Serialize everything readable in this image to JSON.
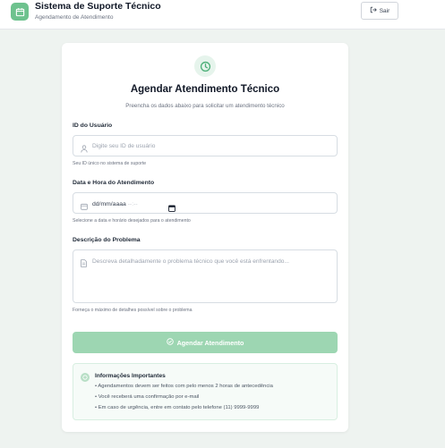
{
  "header": {
    "title": "Sistema de Suporte Técnico",
    "subtitle": "Agendamento de Atendimento",
    "logout_icon": "logout-icon",
    "logout_label": "Sair"
  },
  "form": {
    "title": "Agendar Atendimento Técnico",
    "subtitle": "Preencha os dados abaixo para solicitar um atendimento técnico",
    "user_id": {
      "label": "ID do Usuário",
      "placeholder": "Digite seu ID de usuário",
      "help": "Seu ID único no sistema de suporte",
      "icon": "user-icon"
    },
    "datetime": {
      "label": "Data e Hora do Atendimento",
      "date_placeholder": "dd/mm/aaaa",
      "time_placeholder": "--:--",
      "help": "Selecione a data e horário desejados para o atendimento",
      "icon": "calendar-icon"
    },
    "description": {
      "label": "Descrição do Problema",
      "placeholder": "Descreva detalhadamente o problema técnico que você está enfrentando...",
      "help": "Forneça o máximo de detalhes possível sobre o problema",
      "icon": "document-icon"
    },
    "submit_label": "Agendar Atendimento"
  },
  "info": {
    "title": "Informações Importantes",
    "items": [
      "• Agendamentos devem ser feitos com pelo menos 2 horas de antecedência",
      "• Você receberá uma confirmação por e-mail",
      "• Em caso de urgência, entre em contato pelo telefone (11) 9999-9999"
    ]
  },
  "colors": {
    "background": "#eef3f0",
    "accent": "#6ec28e",
    "button_disabled": "#9dd6b2",
    "info_background": "#f6fbf8"
  }
}
